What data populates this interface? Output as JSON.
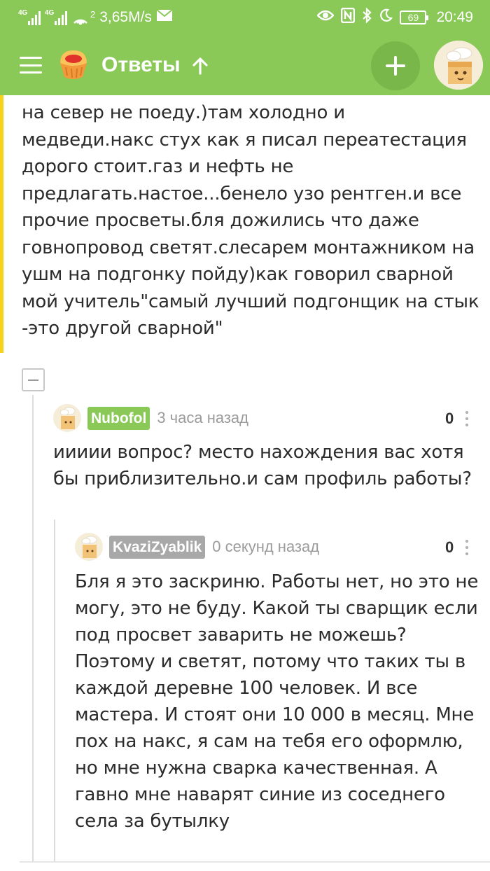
{
  "status_bar": {
    "network_1": "4G",
    "network_2": "4G",
    "hotspot_count": "2",
    "speed": "3,65M/s",
    "battery": "69",
    "time": "20:49"
  },
  "app_bar": {
    "title": "Ответы",
    "menu_icon": "hamburger-menu",
    "add_icon": "plus",
    "up_icon": "arrow-up"
  },
  "parent_comment": {
    "lines": [
      "на север не поеду.)там холодно и",
      "медведи.накс стух как я писал переатестация",
      "дорого стоит.газ и нефть не",
      "предлагать.настое...бенело узо рентген.и все",
      "прочие просветы.бля дожились что даже",
      "говнопровод светят.слесарем монтажником на",
      "ушм на подгонку пойду)как говорил сварной",
      "мой учитель\"самый лучший подгонщик на стык",
      "-это другой сварной\""
    ]
  },
  "comments": [
    {
      "user": "Nubofol",
      "user_color": "#8ac858",
      "time": "3 часа назад",
      "rating": "0",
      "lines": [
        "иииии вопрос? место нахождения вас хотя",
        "бы приблизительно.и сам профиль работы?"
      ]
    },
    {
      "user": "KvaziZyablik",
      "user_color": "#a8a8a8",
      "time": "0 секунд назад",
      "rating": "0",
      "lines": [
        "Бля я это заскриню. Работы нет, но это не",
        "могу, это не буду. Какой ты сварщик если",
        "под просвет заварить не можешь?",
        "Поэтому и светят, потому что таких ты в",
        "каждой деревне 100 человек. И все",
        "мастера. И стоят они 10 000 в месяц. Мне",
        "пох на накс, я сам на тебя его оформлю,",
        "но мне нужна сварка качественная. А",
        "гавно мне наварят синие из соседнего",
        "села за бутылку"
      ]
    }
  ],
  "colors": {
    "header_green": "#8ac858",
    "add_button_green": "#79b74a",
    "accent_yellow": "#f5d31d"
  }
}
